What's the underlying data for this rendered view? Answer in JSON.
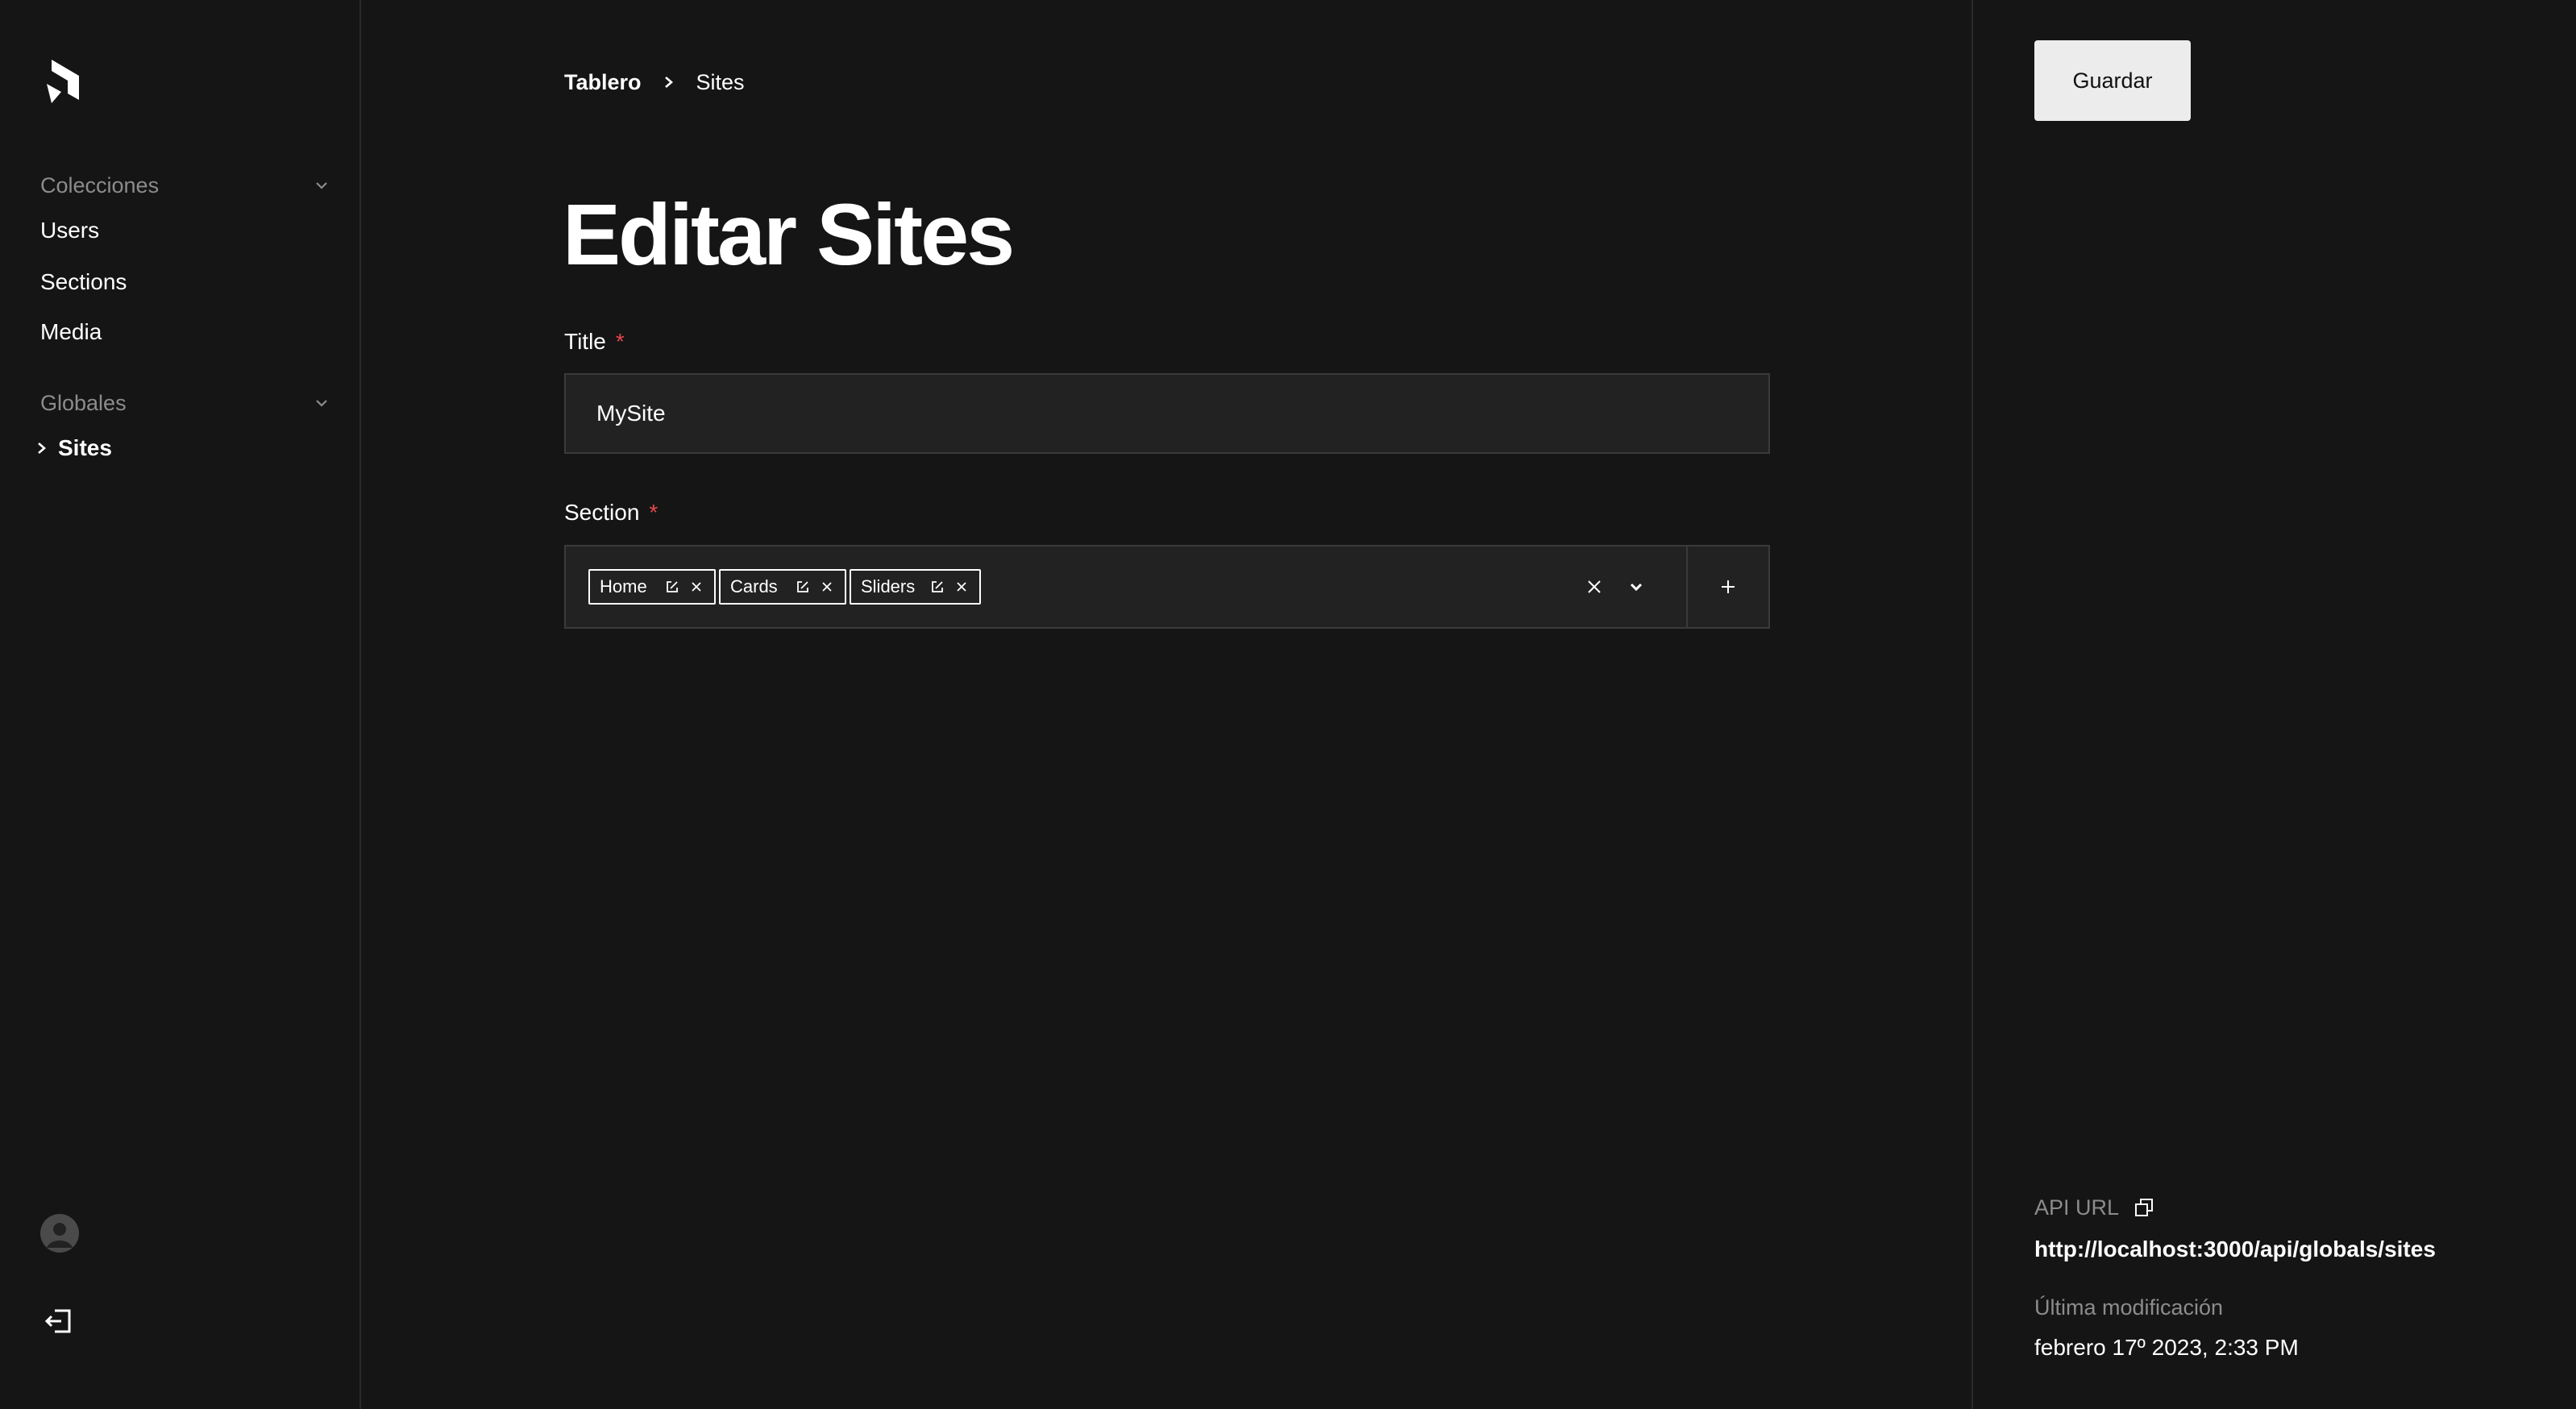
{
  "sidebar": {
    "groups": [
      {
        "label": "Colecciones",
        "items": [
          {
            "label": "Users"
          },
          {
            "label": "Sections"
          },
          {
            "label": "Media"
          }
        ]
      },
      {
        "label": "Globales",
        "items": [
          {
            "label": "Sites",
            "active": true
          }
        ]
      }
    ]
  },
  "breadcrumb": {
    "root": "Tablero",
    "current": "Sites"
  },
  "page": {
    "title": "Editar Sites"
  },
  "fields": {
    "title": {
      "label": "Title",
      "required_mark": "*",
      "value": "MySite"
    },
    "section": {
      "label": "Section",
      "required_mark": "*",
      "chips": [
        {
          "label": "Home"
        },
        {
          "label": "Cards"
        },
        {
          "label": "Sliders"
        }
      ]
    }
  },
  "actions": {
    "save_label": "Guardar"
  },
  "meta": {
    "api_url_label": "API URL",
    "api_url": "http://localhost:3000/api/globals/sites",
    "last_modified_label": "Última modificación",
    "last_modified": "febrero 17º 2023, 2:33 PM"
  },
  "icons": {
    "logo": "payload-logo-icon",
    "chevron": "chevron-down-icon",
    "arrow": "chevron-right-icon",
    "edit": "edit-icon",
    "close": "close-icon",
    "add": "plus-icon",
    "copy": "copy-icon",
    "avatar": "user-avatar-icon",
    "logout": "logout-icon"
  },
  "colors": {
    "background": "#151515",
    "required": "#e5484d",
    "save_button": "#ececec"
  }
}
